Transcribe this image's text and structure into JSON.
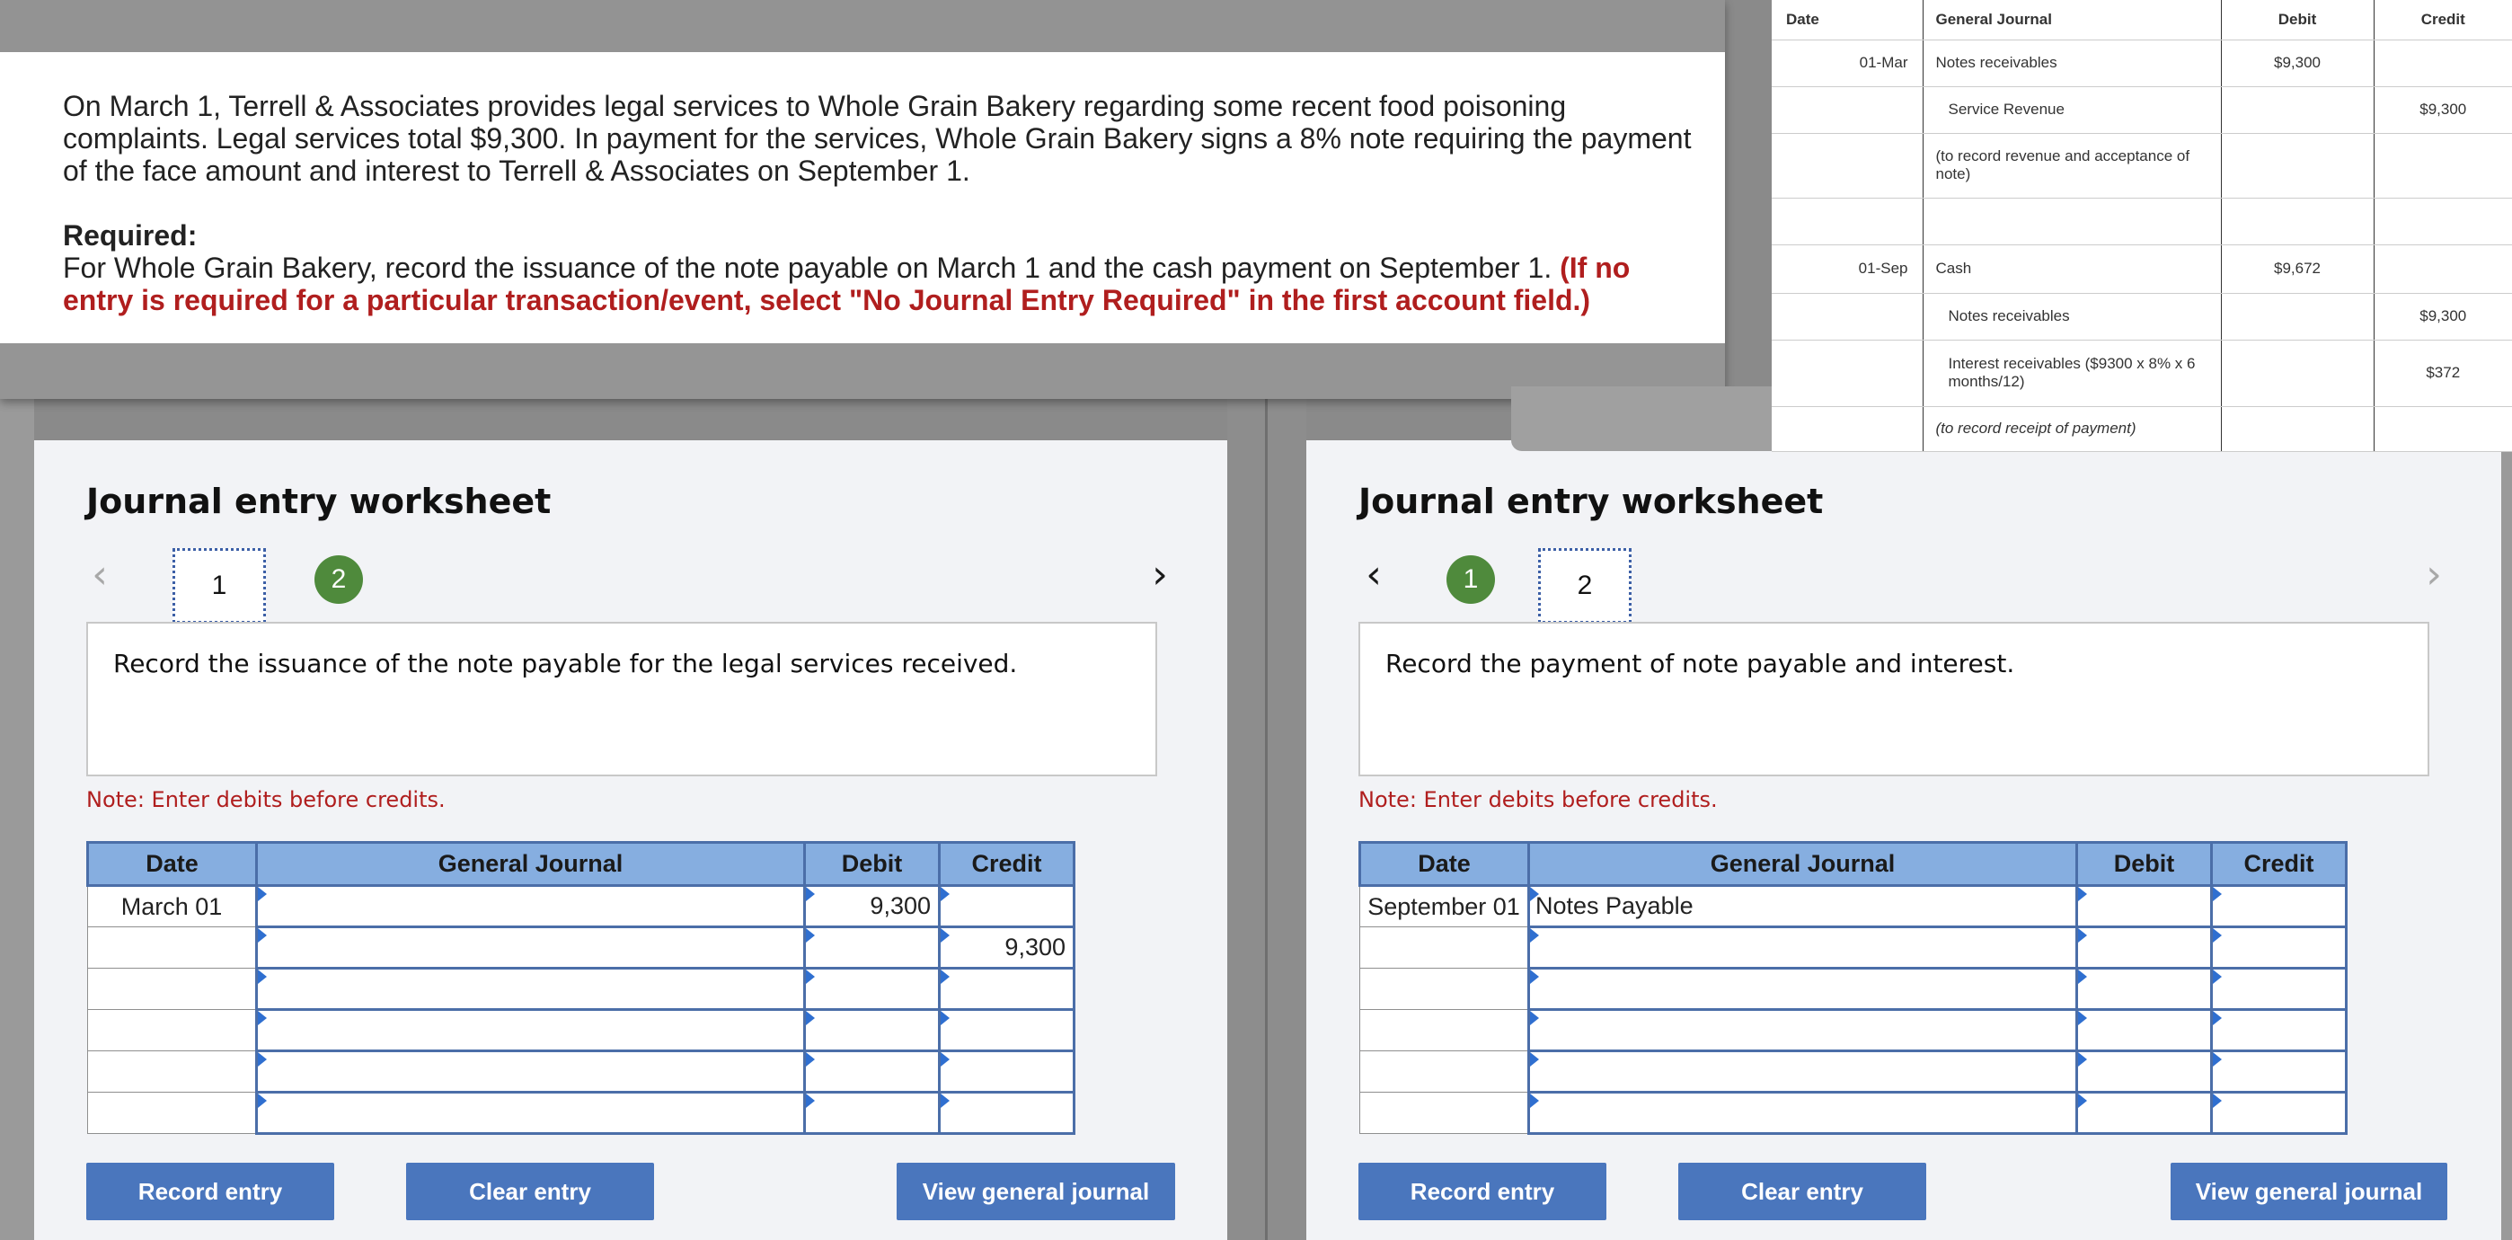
{
  "problem": {
    "paragraph": "On March 1, Terrell & Associates provides legal services to Whole Grain Bakery regarding some recent food poisoning complaints. Legal services total $9,300. In payment for the services, Whole Grain Bakery signs a 8% note requiring the payment of the face amount and interest to Terrell & Associates on September 1.",
    "required_label": "Required:",
    "required_text": "For Whole Grain Bakery, record the issuance of the note payable on March 1 and the cash payment on September 1.",
    "required_note": "(If no entry is required for a particular transaction/event, select \"No Journal Entry Required\" in the first account field.)"
  },
  "general_journal": {
    "headers": [
      "Date",
      "General Journal",
      "Debit",
      "Credit"
    ],
    "rows": [
      {
        "date": "01-Mar",
        "account": "Notes receivables",
        "debit": "$9,300",
        "credit": "",
        "style": "normal"
      },
      {
        "date": "",
        "account": "Service Revenue",
        "debit": "",
        "credit": "$9,300",
        "style": "indent"
      },
      {
        "date": "",
        "account": "(to record revenue and acceptance of note)",
        "debit": "",
        "credit": "",
        "style": "normal"
      },
      {
        "date": "",
        "account": "",
        "debit": "",
        "credit": "",
        "style": "normal"
      },
      {
        "date": "01-Sep",
        "account": "Cash",
        "debit": "$9,672",
        "credit": "",
        "style": "normal"
      },
      {
        "date": "",
        "account": "Notes receivables",
        "debit": "",
        "credit": "$9,300",
        "style": "indent"
      },
      {
        "date": "",
        "account": "Interest receivables ($9300 x 8% x 6 months/12)",
        "debit": "",
        "credit": "$372",
        "style": "indent"
      },
      {
        "date": "",
        "account": "(to record receipt of payment)",
        "debit": "",
        "credit": "",
        "style": "italic"
      }
    ]
  },
  "worksheet_left": {
    "title": "Journal entry worksheet",
    "prev_arrow": "‹",
    "next_arrow": "›",
    "step_current": "1",
    "step_other": "2",
    "instruction": "Record the issuance of the note payable for the legal services received.",
    "note": "Note: Enter debits before credits.",
    "headers": [
      "Date",
      "General Journal",
      "Debit",
      "Credit"
    ],
    "rows": [
      {
        "date": "March 01",
        "account": "",
        "debit": "9,300",
        "credit": ""
      },
      {
        "date": "",
        "account": "",
        "debit": "",
        "credit": "9,300"
      },
      {
        "date": "",
        "account": "",
        "debit": "",
        "credit": ""
      },
      {
        "date": "",
        "account": "",
        "debit": "",
        "credit": ""
      },
      {
        "date": "",
        "account": "",
        "debit": "",
        "credit": ""
      },
      {
        "date": "",
        "account": "",
        "debit": "",
        "credit": ""
      }
    ],
    "record_button": "Record entry",
    "clear_button": "Clear entry",
    "view_button": "View general journal"
  },
  "worksheet_right": {
    "title": "Journal entry worksheet",
    "prev_arrow": "‹",
    "next_arrow": "›",
    "step_current": "2",
    "step_other": "1",
    "instruction": "Record the payment of note payable and interest.",
    "note": "Note: Enter debits before credits.",
    "headers": [
      "Date",
      "General Journal",
      "Debit",
      "Credit"
    ],
    "rows": [
      {
        "date": "September 01",
        "account": "Notes Payable",
        "debit": "",
        "credit": ""
      },
      {
        "date": "",
        "account": "",
        "debit": "",
        "credit": ""
      },
      {
        "date": "",
        "account": "",
        "debit": "",
        "credit": ""
      },
      {
        "date": "",
        "account": "",
        "debit": "",
        "credit": ""
      },
      {
        "date": "",
        "account": "",
        "debit": "",
        "credit": ""
      },
      {
        "date": "",
        "account": "",
        "debit": "",
        "credit": ""
      }
    ],
    "record_button": "Record entry",
    "clear_button": "Clear entry",
    "view_button": "View general journal"
  },
  "colors": {
    "accent_blue": "#4a76bd",
    "header_blue": "#86aee0",
    "step_green": "#4f8a3c",
    "warning_red": "#b01e1e"
  }
}
